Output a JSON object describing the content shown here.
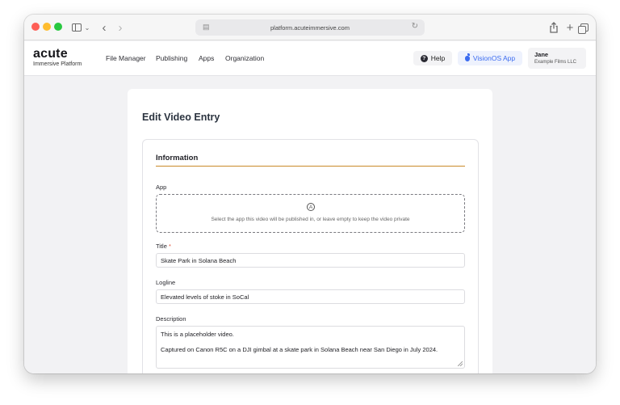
{
  "browser": {
    "url": "platform.acuteimmersive.com",
    "controls": {
      "close": "close",
      "minimize": "minimize",
      "zoom": "zoom",
      "sidebar": "sidebar-icon",
      "back": "back-arrow-icon",
      "forward": "forward-arrow-icon",
      "reload": "reload-icon",
      "share": "share-icon",
      "new_tab": "plus-icon",
      "tab_overview": "tabs-icon"
    }
  },
  "header": {
    "brand_name": "acute",
    "brand_sub": "Immersive Platform",
    "nav": [
      "File Manager",
      "Publishing",
      "Apps",
      "Organization"
    ],
    "help_label": "Help",
    "visionos_label": "VisionOS App",
    "user_name": "Jane",
    "user_org": "Example Films LLC",
    "accent_color": "#3c6cf0"
  },
  "main": {
    "page_title": "Edit Video Entry",
    "section_title": "Information",
    "section_rule_color": "#c98a2a",
    "app_label": "App",
    "app_dropzone_text": "Select the app this video will be published in, or leave empty to keep the video private",
    "title_label": "Title",
    "title_required": "*",
    "title_value": "Skate Park in Solana Beach",
    "logline_label": "Logline",
    "logline_value": "Elevated levels of stoke in SoCal",
    "description_label": "Description",
    "description_line1": "This is a placeholder video.",
    "description_line2": "Captured on Canon R5C on a DJI gimbal at a skate park in Solana Beach near San Diego in July 2024."
  }
}
